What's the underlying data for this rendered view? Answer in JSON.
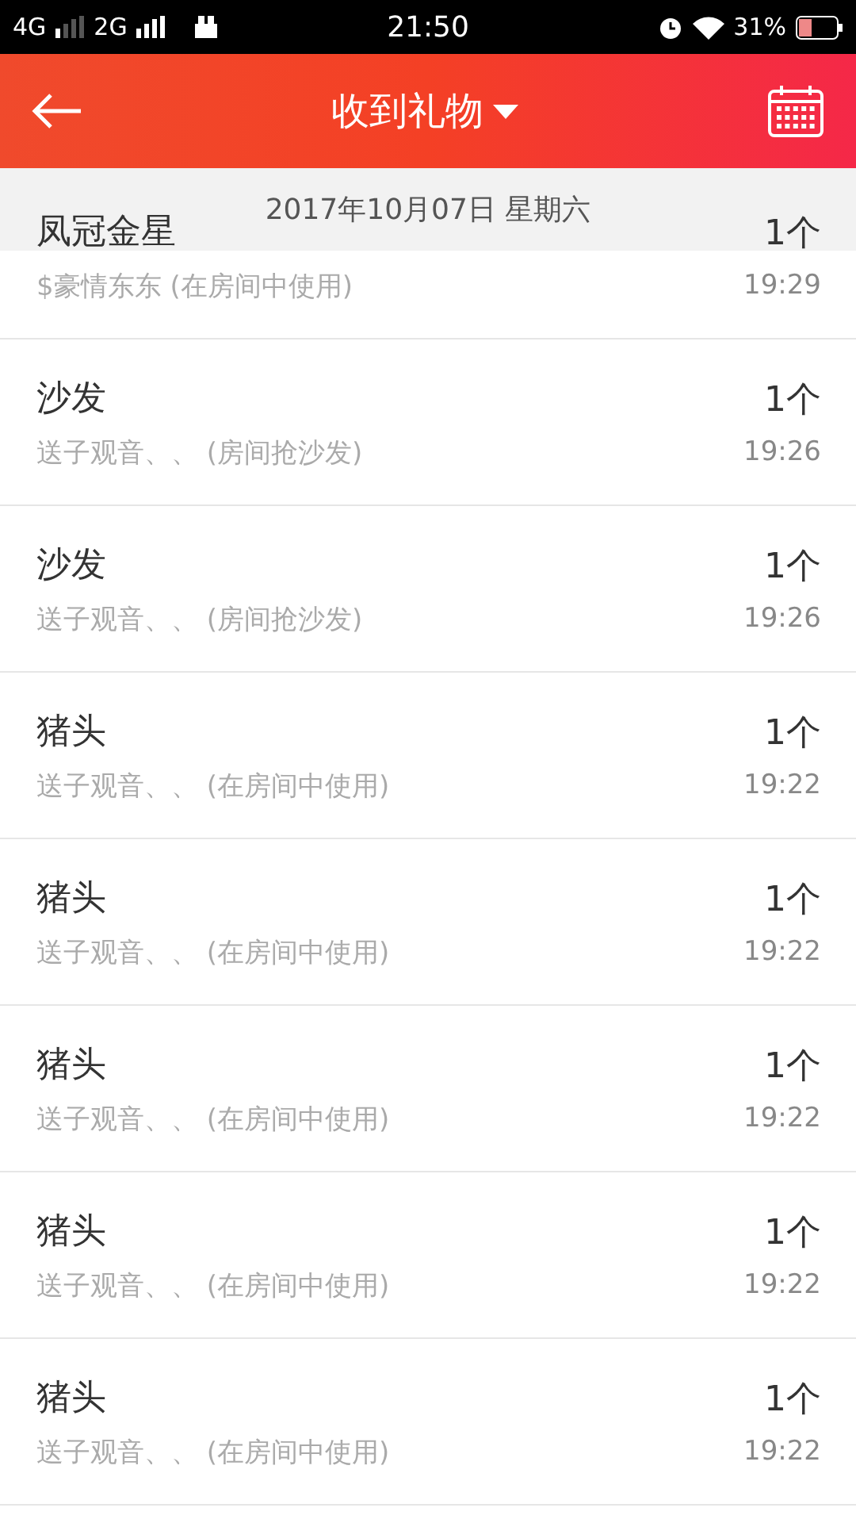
{
  "status_bar": {
    "carrier_1": "4G",
    "carrier_2": "2G",
    "time": "21:50",
    "battery": "31%"
  },
  "header": {
    "title": "收到礼物"
  },
  "date_header": "2017年10月07日 星期六",
  "rows": [
    {
      "name": "凤冠金星",
      "detail": "$豪情东东 (在房间中使用)",
      "count": "1个",
      "time": "19:29"
    },
    {
      "name": "沙发",
      "detail": "送子观音、、 (房间抢沙发)",
      "count": "1个",
      "time": "19:26"
    },
    {
      "name": "沙发",
      "detail": "送子观音、、 (房间抢沙发)",
      "count": "1个",
      "time": "19:26"
    },
    {
      "name": "猪头",
      "detail": "送子观音、、 (在房间中使用)",
      "count": "1个",
      "time": "19:22"
    },
    {
      "name": "猪头",
      "detail": "送子观音、、 (在房间中使用)",
      "count": "1个",
      "time": "19:22"
    },
    {
      "name": "猪头",
      "detail": "送子观音、、 (在房间中使用)",
      "count": "1个",
      "time": "19:22"
    },
    {
      "name": "猪头",
      "detail": "送子观音、、 (在房间中使用)",
      "count": "1个",
      "time": "19:22"
    },
    {
      "name": "猪头",
      "detail": "送子观音、、 (在房间中使用)",
      "count": "1个",
      "time": "19:22"
    }
  ]
}
